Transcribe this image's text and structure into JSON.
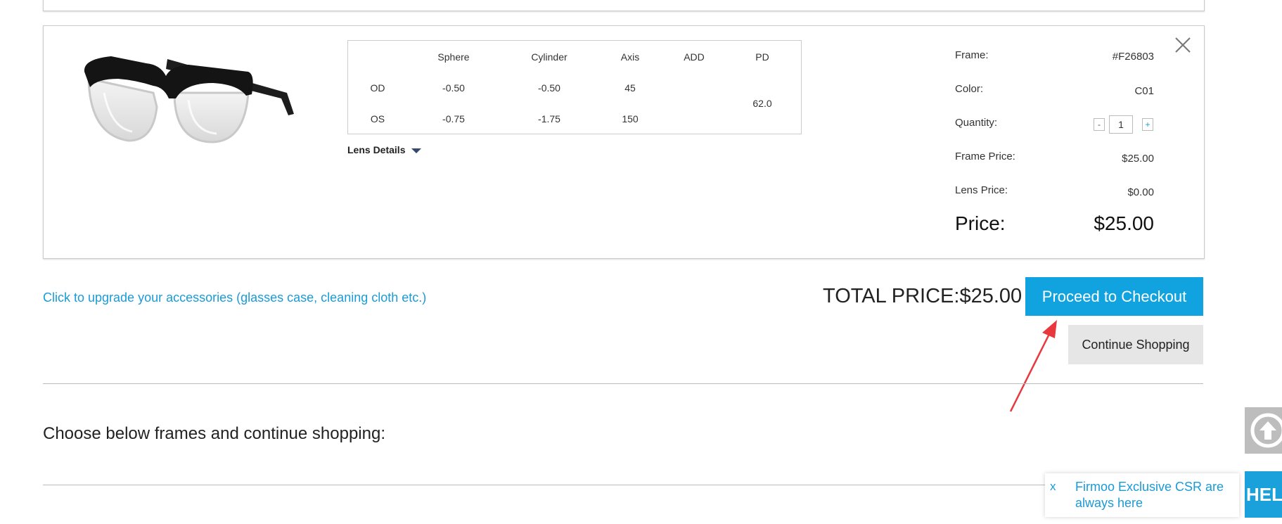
{
  "product": {
    "image_alt": "Black and clear glasses frame",
    "prescription": {
      "headers": [
        "",
        "Sphere",
        "Cylinder",
        "Axis",
        "ADD",
        "PD"
      ],
      "rows": [
        {
          "eye": "OD",
          "sphere": "-0.50",
          "cylinder": "-0.50",
          "axis": "45",
          "add": ""
        },
        {
          "eye": "OS",
          "sphere": "-0.75",
          "cylinder": "-1.75",
          "axis": "150",
          "add": ""
        }
      ],
      "pd": "62.0"
    },
    "lens_details_label": "Lens Details",
    "details": {
      "frame_label": "Frame:",
      "frame_value": "#F26803",
      "color_label": "Color:",
      "color_value": "C01",
      "quantity_label": "Quantity:",
      "quantity_value": "1",
      "qty_minus": "-",
      "qty_plus": "+",
      "frame_price_label": "Frame Price:",
      "frame_price_value": "$25.00",
      "lens_price_label": "Lens Price:",
      "lens_price_value": "$0.00",
      "price_label": "Price:",
      "price_value": "$25.00"
    }
  },
  "cart": {
    "upgrade_link": "Click to upgrade your accessories (glasses case, cleaning cloth etc.)",
    "total_price": "TOTAL PRICE:$25.00",
    "checkout_label": "Proceed to Checkout",
    "continue_label": "Continue Shopping"
  },
  "recommendations": {
    "heading": "Choose below frames and continue shopping:"
  },
  "widgets": {
    "help_label": "HELP",
    "chat_close": "x",
    "chat_message": "Firmoo Exclusive CSR are always here"
  },
  "colors": {
    "accent": "#11a3e0",
    "link": "#1a9bd7",
    "annotation_arrow": "#e8383d"
  },
  "icons": {
    "close": "close-icon",
    "lens_caret": "caret-down-icon",
    "back_to_top": "arrow-up-circle-icon"
  }
}
